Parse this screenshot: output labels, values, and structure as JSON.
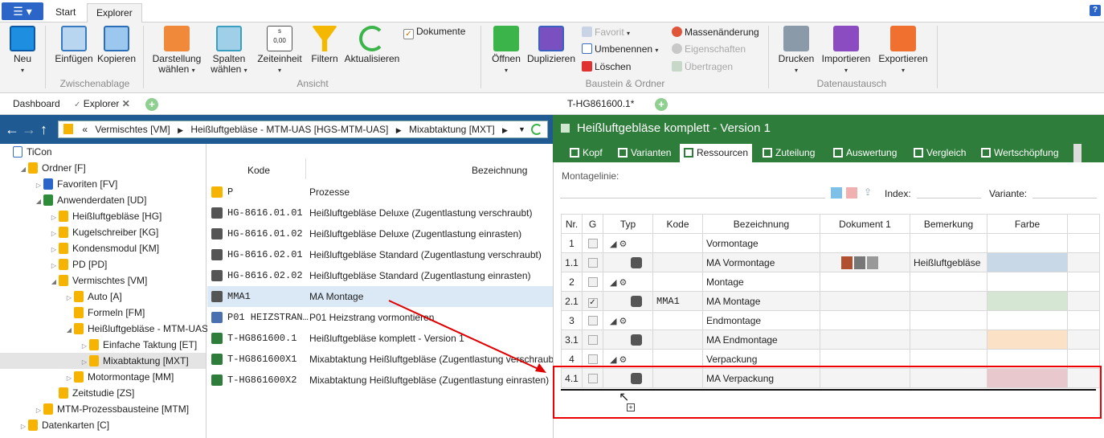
{
  "ribbon_tabs": {
    "start": "Start",
    "explorer": "Explorer"
  },
  "ribbon": {
    "neu": "Neu",
    "einfuegen": "Einfügen",
    "kopieren": "Kopieren",
    "group_zwischenablage": "Zwischenablage",
    "darstellung": "Darstellung",
    "darstellung2": "wählen",
    "spalten": "Spalten",
    "spalten2": "wählen",
    "zeiteinheit": "Zeiteinheit",
    "filtern": "Filtern",
    "aktualisieren": "Aktualisieren",
    "dokumente": "Dokumente",
    "group_ansicht": "Ansicht",
    "oeffnen": "Öffnen",
    "duplizieren": "Duplizieren",
    "favorit": "Favorit",
    "umbenennen": "Umbenennen",
    "loeschen": "Löschen",
    "massenaenderung": "Massenänderung",
    "eigenschaften": "Eigenschaften",
    "uebertragen": "Übertragen",
    "group_baustein": "Baustein & Ordner",
    "drucken": "Drucken",
    "importieren": "Importieren",
    "exportieren": "Exportieren",
    "group_datenaustausch": "Datenaustausch",
    "zeiteinheit_icon_text": "s",
    "zeiteinheit_icon_value": "0,00"
  },
  "doc_tabs": {
    "dashboard": "Dashboard",
    "explorer": "Explorer",
    "right": "T-HG861600.1*"
  },
  "breadcrumb": [
    "Vermischtes [VM]",
    "Heißluftgebläse - MTM-UAS [HGS-MTM-UAS]",
    "Mixabtaktung [MXT]"
  ],
  "tree": [
    {
      "label": "TiCon",
      "indent": 0,
      "tw": ""
    },
    {
      "label": "Ordner [F]",
      "indent": 1,
      "tw": "◢"
    },
    {
      "label": "Favoriten [FV]",
      "indent": 2,
      "tw": "▷"
    },
    {
      "label": "Anwenderdaten [UD]",
      "indent": 2,
      "tw": "◢"
    },
    {
      "label": "Heißluftgebläse [HG]",
      "indent": 3,
      "tw": "▷"
    },
    {
      "label": "Kugelschreiber [KG]",
      "indent": 3,
      "tw": "▷"
    },
    {
      "label": "Kondensmodul [KM]",
      "indent": 3,
      "tw": "▷"
    },
    {
      "label": "PD [PD]",
      "indent": 3,
      "tw": "▷"
    },
    {
      "label": "Vermischtes [VM]",
      "indent": 3,
      "tw": "◢"
    },
    {
      "label": "Auto [A]",
      "indent": 4,
      "tw": "▷"
    },
    {
      "label": "Formeln [FM]",
      "indent": 4,
      "tw": ""
    },
    {
      "label": "Heißluftgebläse - MTM-UAS",
      "indent": 4,
      "tw": "◢"
    },
    {
      "label": "Einfache Taktung [ET]",
      "indent": 5,
      "tw": "▷"
    },
    {
      "label": "Mixabtaktung [MXT]",
      "indent": 5,
      "tw": "▷"
    },
    {
      "label": "Motormontage [MM]",
      "indent": 4,
      "tw": "▷"
    },
    {
      "label": "Zeitstudie [ZS]",
      "indent": 3,
      "tw": ""
    },
    {
      "label": "MTM-Prozessbausteine [MTM]",
      "indent": 2,
      "tw": "▷"
    },
    {
      "label": "Datenkarten [C]",
      "indent": 1,
      "tw": "▷"
    }
  ],
  "list": {
    "col_kode": "Kode",
    "col_bez": "Bezeichnung",
    "rows": [
      {
        "kode": "P",
        "bez": "Prozesse"
      },
      {
        "kode": "HG-8616.01.01",
        "bez": "Heißluftgebläse Deluxe (Zugentlastung verschraubt)"
      },
      {
        "kode": "HG-8616.01.02",
        "bez": "Heißluftgebläse Deluxe (Zugentlastung einrasten)"
      },
      {
        "kode": "HG-8616.02.01",
        "bez": "Heißluftgebläse Standard (Zugentlastung verschraubt)"
      },
      {
        "kode": "HG-8616.02.02",
        "bez": "Heißluftgebläse Standard (Zugentlastung einrasten)"
      },
      {
        "kode": "MMA1",
        "bez": "MA Montage"
      },
      {
        "kode": "P01 HEIZSTRAN…",
        "bez": "P01 Heizstrang vormontieren"
      },
      {
        "kode": "T-HG861600.1",
        "bez": "Heißluftgebläse komplett - Version 1"
      },
      {
        "kode": "T-HG861600X1",
        "bez": "Mixabtaktung Heißluftgebläse (Zugentlastung verschraub"
      },
      {
        "kode": "T-HG861600X2",
        "bez": "Mixabtaktung Heißluftgebläse (Zugentlastung einrasten)"
      }
    ]
  },
  "right": {
    "title": "Heißluftgebläse komplett - Version 1",
    "tabs": [
      "Kopf",
      "Varianten",
      "Ressourcen",
      "Zuteilung",
      "Auswertung",
      "Vergleich",
      "Wertschöpfung"
    ],
    "montagelinie": "Montagelinie:",
    "index": "Index:",
    "variante": "Variante:",
    "cols": [
      "Nr.",
      "G",
      "Typ",
      "Kode",
      "Bezeichnung",
      "Dokument 1",
      "Bemerkung",
      "Farbe"
    ],
    "rows": [
      {
        "nr": "1",
        "kode": "",
        "bez": "Vormontage",
        "bem": "",
        "color": ""
      },
      {
        "nr": "1.1",
        "kode": "",
        "bez": "MA Vormontage",
        "bem": "Heißluftgebläse",
        "color": "#c9d8e6"
      },
      {
        "nr": "2",
        "kode": "",
        "bez": "Montage",
        "bem": "",
        "color": ""
      },
      {
        "nr": "2.1",
        "kode": "MMA1",
        "bez": "MA Montage",
        "bem": "",
        "color": "#d5e6d2"
      },
      {
        "nr": "3",
        "kode": "",
        "bez": "Endmontage",
        "bem": "",
        "color": ""
      },
      {
        "nr": "3.1",
        "kode": "",
        "bez": "MA Endmontage",
        "bem": "",
        "color": "#fbe1c6"
      },
      {
        "nr": "4",
        "kode": "",
        "bez": "Verpackung",
        "bem": "",
        "color": ""
      },
      {
        "nr": "4.1",
        "kode": "",
        "bez": "MA Verpackung",
        "bem": "",
        "color": "#e8c8cc"
      }
    ]
  }
}
